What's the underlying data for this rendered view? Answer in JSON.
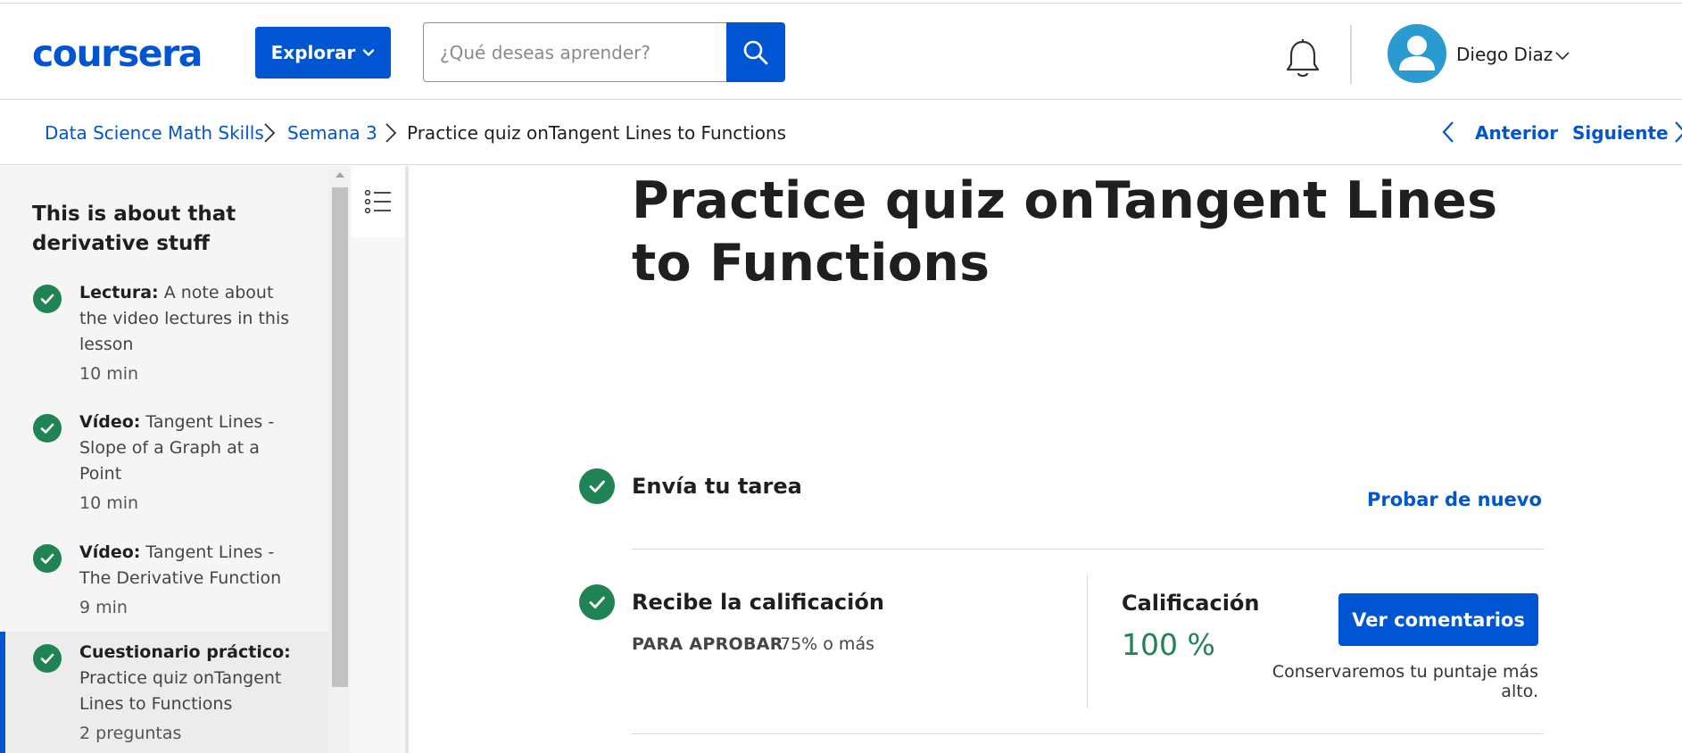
{
  "header": {
    "logo": "coursera",
    "explore_label": "Explorar",
    "search_placeholder": "¿Qué deseas aprender?",
    "user_name": "Diego Diaz"
  },
  "breadcrumb": {
    "items": [
      "Data Science Math Skills",
      "Semana 3"
    ],
    "current": "Practice quiz onTangent Lines to Functions",
    "prev_label": "Anterior",
    "next_label": "Siguiente"
  },
  "sidebar": {
    "title": "This is about that derivative stuff",
    "items": [
      {
        "type": "Lectura:",
        "title": "A note about the video lectures in this lesson",
        "meta": "10 min",
        "completed": true
      },
      {
        "type": "Vídeo:",
        "title": "Tangent Lines - Slope of a Graph at a Point",
        "meta": "10 min",
        "completed": true
      },
      {
        "type": "Vídeo:",
        "title": "Tangent Lines - The Derivative Function",
        "meta": "9 min",
        "completed": true
      },
      {
        "type": "Cuestionario práctico:",
        "title": "Practice quiz onTangent Lines to Functions",
        "meta": "2 preguntas",
        "completed": true
      }
    ]
  },
  "main": {
    "title": "Practice quiz onTangent Lines to Functions",
    "submit_step": "Envía tu tarea",
    "retry_label": "Probar de nuevo",
    "grade_step": "Recibe la calificación",
    "pass_label": "PARA APROBAR",
    "pass_value": "75% o más",
    "grade_label": "Calificación",
    "grade_value": "100 %",
    "feedback_button": "Ver comentarios",
    "keep_note": "Conservaremos tu puntaje más alto."
  },
  "colors": {
    "brand": "#0056d2",
    "success": "#1f8354"
  }
}
